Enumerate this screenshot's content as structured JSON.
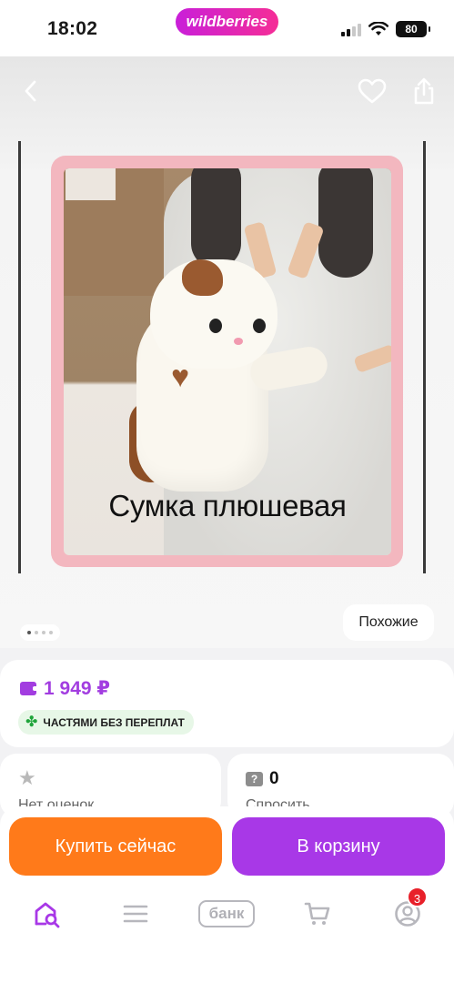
{
  "status_bar": {
    "time": "18:02",
    "brand": "wildberries",
    "battery": "80"
  },
  "product": {
    "image_caption": "Сумка плюшевая",
    "similar_label": "Похожие",
    "gallery_total": 4,
    "gallery_active": 1
  },
  "price": {
    "value": "1 949 ₽",
    "installment_label": "ЧАСТЯМИ БЕЗ ПЕРЕПЛАТ"
  },
  "rating_card": {
    "label": "Нет оценок"
  },
  "ask_card": {
    "count": "0",
    "label": "Спросить"
  },
  "actions": {
    "buy_now": "Купить сейчас",
    "add_to_cart": "В корзину"
  },
  "tabbar": {
    "bank_label": "банк",
    "profile_badge": "3"
  },
  "colors": {
    "price_accent": "#a23de0",
    "buy_button": "#ff7a1a",
    "cart_button": "#a838e7",
    "badge": "#e8202a",
    "installment_bg": "#e7f7e7"
  },
  "icons": [
    "back-arrow-icon",
    "heart-icon",
    "share-icon",
    "wallet-icon",
    "clover-icon",
    "star-icon",
    "question-icon",
    "home-search-icon",
    "menu-icon",
    "cart-icon",
    "profile-icon",
    "wifi-icon",
    "signal-icon",
    "battery-icon"
  ]
}
